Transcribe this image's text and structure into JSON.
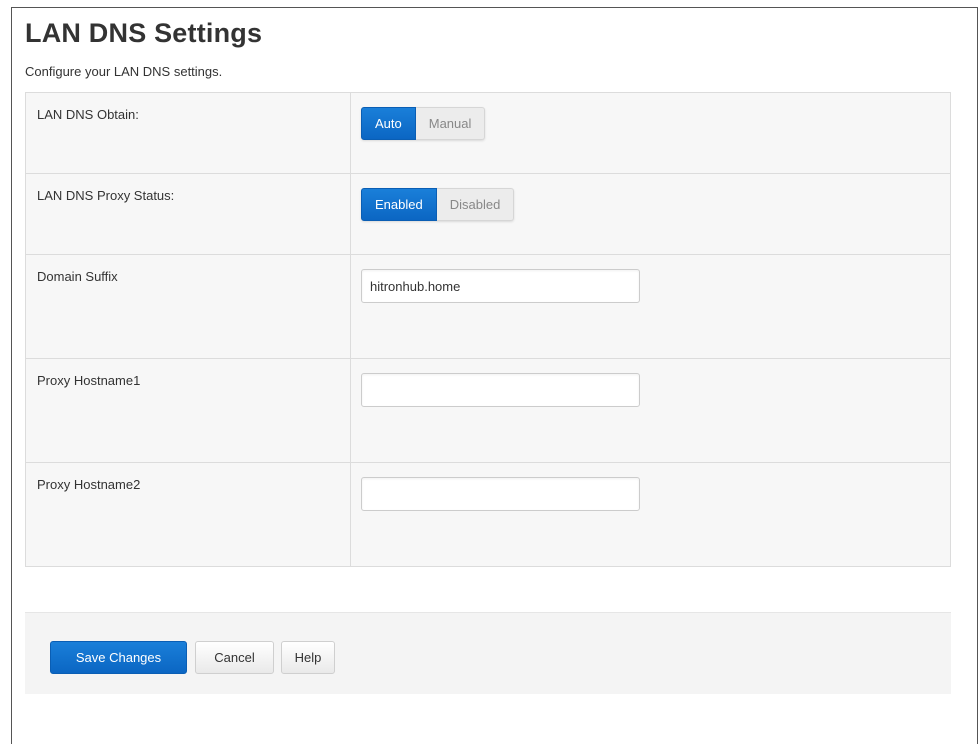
{
  "page": {
    "title": "LAN DNS Settings",
    "description": "Configure your LAN DNS settings."
  },
  "settings": {
    "dns_obtain": {
      "label": "LAN DNS Obtain:",
      "options": [
        "Auto",
        "Manual"
      ],
      "selected": "Auto"
    },
    "dns_proxy_status": {
      "label": "LAN DNS Proxy Status:",
      "options": [
        "Enabled",
        "Disabled"
      ],
      "selected": "Enabled"
    },
    "domain_suffix": {
      "label": "Domain Suffix",
      "value": "hitronhub.home",
      "placeholder": ""
    },
    "proxy_hostname1": {
      "label": "Proxy Hostname1",
      "value": "",
      "placeholder": ""
    },
    "proxy_hostname2": {
      "label": "Proxy Hostname2",
      "value": "",
      "placeholder": ""
    }
  },
  "actions": {
    "save_label": "Save Changes",
    "cancel_label": "Cancel",
    "help_label": "Help"
  },
  "colors": {
    "accent": "#0b66c3",
    "inactive_bg": "#ececec",
    "table_bg": "#f7f7f7"
  }
}
